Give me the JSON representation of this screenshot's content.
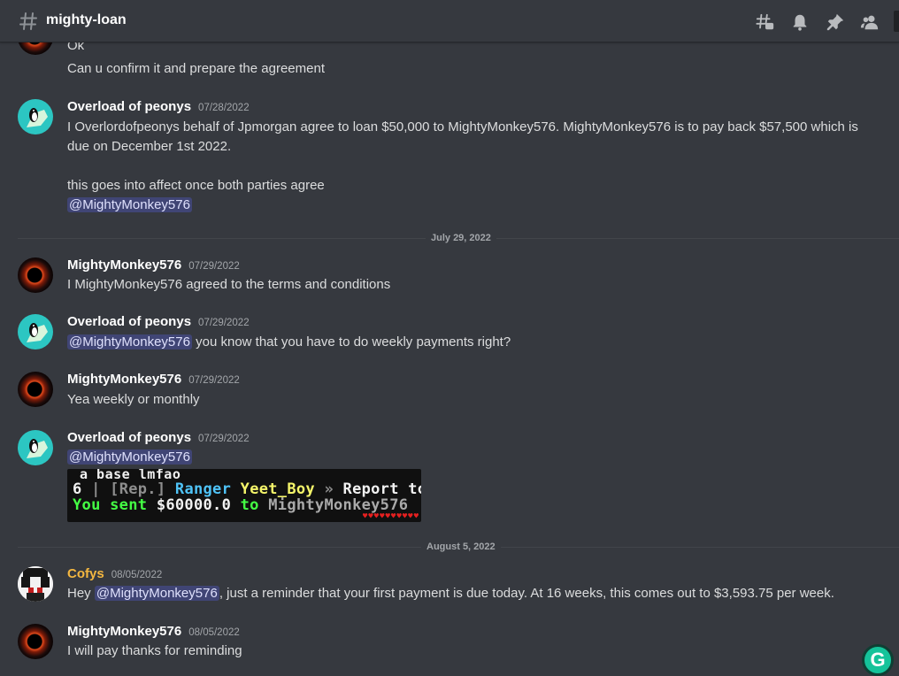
{
  "header": {
    "channel_name": "mighty-loan",
    "icons": [
      "threads-icon",
      "bell-icon",
      "pin-icon",
      "members-icon"
    ]
  },
  "colors": {
    "background": "#36393f",
    "mention_bg": "#5865f24d",
    "cofys_name": "#f4b740",
    "teal_avatar": "#2cc6c2"
  },
  "messages": [
    {
      "lines": [
        "Ok",
        "Can u confirm it and prepare the agreement"
      ]
    },
    {
      "author": "Overload of peonys",
      "timestamp": "07/28/2022",
      "lines": [
        "I Overlordofpeonys behalf of Jpmorgan agree to loan $50,000 to MightyMonkey576. MightyMonkey576 is to pay back $57,500 which is",
        "due on December 1st 2022.",
        "this goes into affect once both parties agree"
      ],
      "mention": "@MightyMonkey576"
    },
    {
      "author": "MightyMonkey576",
      "timestamp": "07/29/2022",
      "text": "I MightyMonkey576 agreed to the terms and conditions"
    },
    {
      "author": "Overload of peonys",
      "timestamp": "07/29/2022",
      "mention": "@MightyMonkey576",
      "text": " you know that you have to do weekly payments right?"
    },
    {
      "author": "MightyMonkey576",
      "timestamp": "07/29/2022",
      "text": "Yea weekly or monthly"
    },
    {
      "author": "Overload of peonys",
      "timestamp": "07/29/2022",
      "mention": "@MightyMonkey576",
      "attachment": {
        "line0": "a base lmfao",
        "rank_num": "6",
        "sep": " | ",
        "rep": "[Rep.]",
        "rank": " Ranger ",
        "player": "Yeet_Boy",
        "arrow": " » ",
        "action": "Report to",
        "sent_prefix": "You sent ",
        "amount": "$60000.0",
        "to": " to ",
        "recipient": "MightyMonkey576",
        "hearts": "♥♥♥♥♥♥♥♥♥♥"
      }
    },
    {
      "author": "Cofys",
      "timestamp": "08/05/2022",
      "text_before": "Hey ",
      "mention": "@MightyMonkey576",
      "text_after": ", just a reminder that your first payment is due today. At 16 weeks, this comes out to $3,593.75 per week."
    },
    {
      "author": "MightyMonkey576",
      "timestamp": "08/05/2022",
      "text": "I will pay thanks for reminding"
    }
  ],
  "dividers": [
    "July 29, 2022",
    "August 5, 2022"
  ],
  "grammarly": {
    "label": "G"
  }
}
